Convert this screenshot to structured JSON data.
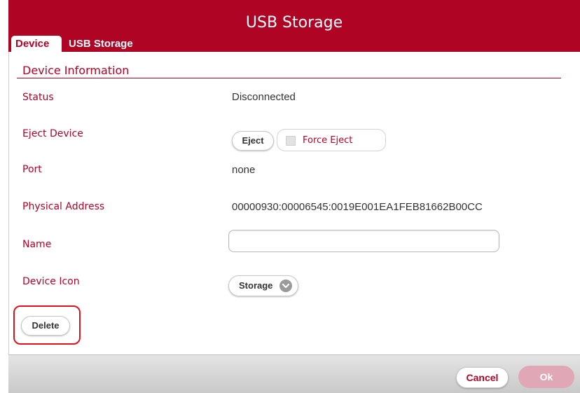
{
  "window": {
    "title": "USB Storage"
  },
  "tabs": [
    {
      "label": "Device",
      "active": true
    },
    {
      "label": "USB Storage",
      "active": false
    }
  ],
  "section": {
    "title": "Device Information"
  },
  "fields": {
    "status": {
      "label": "Status",
      "value": "Disconnected"
    },
    "eject": {
      "label": "Eject Device",
      "button": "Eject",
      "force_label": "Force Eject",
      "force_checked": false
    },
    "port": {
      "label": "Port",
      "value": "none"
    },
    "address": {
      "label": "Physical Address",
      "value": "00000930:00006545:0019E001EA1FEB81662B00CC"
    },
    "name": {
      "label": "Name",
      "value": "",
      "placeholder": ""
    },
    "icon": {
      "label": "Device Icon",
      "selected": "Storage"
    }
  },
  "actions": {
    "delete": "Delete",
    "cancel": "Cancel",
    "ok": "Ok"
  },
  "colors": {
    "accent": "#b00425",
    "highlight": "#d8161b",
    "ok_disabled": "#e0a8b6"
  },
  "icons": {
    "select": "chevron-down-icon",
    "checkbox": "checkbox-icon"
  }
}
